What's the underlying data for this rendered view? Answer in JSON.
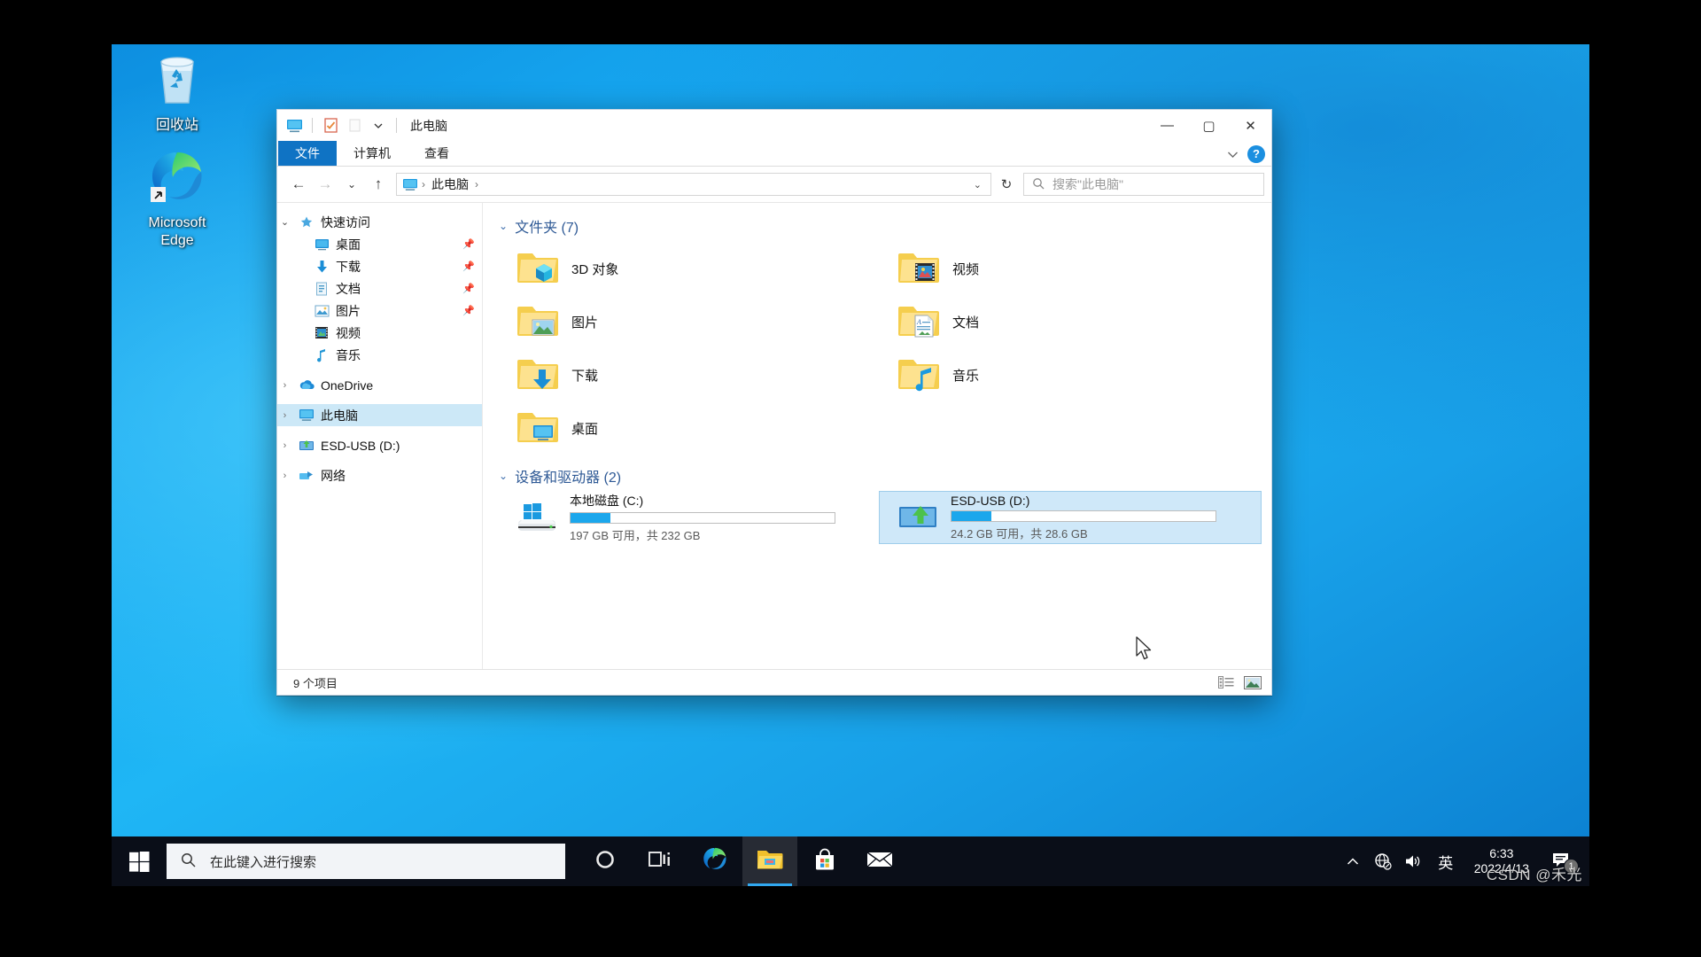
{
  "desktop": {
    "icons": [
      {
        "label": "回收站",
        "icon": "recycle-bin-icon"
      },
      {
        "label": "Microsoft\nEdge",
        "label_line1": "Microsoft",
        "label_line2": "Edge",
        "icon": "microsoft-edge-icon"
      }
    ]
  },
  "window": {
    "title": "此电脑",
    "quick_access": [
      {
        "name": "this-pc-icon"
      },
      {
        "name": "properties-icon"
      },
      {
        "name": "new-folder-icon"
      },
      {
        "name": "customize-dropdown-icon"
      }
    ],
    "controls": {
      "minimize": "—",
      "maximize": "▢",
      "close": "✕"
    },
    "ribbon_tabs": [
      {
        "label": "文件",
        "active": true
      },
      {
        "label": "计算机",
        "active": false
      },
      {
        "label": "查看",
        "active": false
      }
    ],
    "ribbon_right": {
      "collapse": "chevron-down-icon",
      "help": "?"
    },
    "address": {
      "back": "←",
      "forward": "→",
      "recent": "⌄",
      "up": "↑",
      "crumb_icon": "this-pc-icon",
      "crumbs": [
        "此电脑"
      ],
      "crumb_sep": "›",
      "dropdown": "⌄",
      "refresh": "↻"
    },
    "search": {
      "placeholder": "搜索\"此电脑\"",
      "icon": "search-icon"
    },
    "navpane": [
      {
        "label": "快速访问",
        "icon": "star-pin-icon",
        "chevron": "expanded",
        "indent": 0,
        "pinned": false,
        "selected": false
      },
      {
        "label": "桌面",
        "icon": "desktop-icon",
        "chevron": "none",
        "indent": 1,
        "pinned": true,
        "selected": false
      },
      {
        "label": "下载",
        "icon": "downloads-icon",
        "chevron": "none",
        "indent": 1,
        "pinned": true,
        "selected": false
      },
      {
        "label": "文档",
        "icon": "documents-icon",
        "chevron": "none",
        "indent": 1,
        "pinned": true,
        "selected": false
      },
      {
        "label": "图片",
        "icon": "pictures-icon",
        "chevron": "none",
        "indent": 1,
        "pinned": true,
        "selected": false
      },
      {
        "label": "视频",
        "icon": "videos-icon",
        "chevron": "none",
        "indent": 1,
        "pinned": false,
        "selected": false
      },
      {
        "label": "音乐",
        "icon": "music-icon",
        "chevron": "none",
        "indent": 1,
        "pinned": false,
        "selected": false
      },
      {
        "label": "OneDrive",
        "icon": "onedrive-icon",
        "chevron": "collapsed",
        "indent": 0,
        "pinned": false,
        "selected": false
      },
      {
        "label": "此电脑",
        "icon": "this-pc-icon",
        "chevron": "collapsed",
        "indent": 0,
        "pinned": false,
        "selected": true
      },
      {
        "label": "ESD-USB (D:)",
        "icon": "usb-drive-icon",
        "chevron": "collapsed",
        "indent": 0,
        "pinned": false,
        "selected": false
      },
      {
        "label": "网络",
        "icon": "network-icon",
        "chevron": "collapsed",
        "indent": 0,
        "pinned": false,
        "selected": false
      }
    ],
    "groups": {
      "folders": {
        "header": "文件夹 (7)",
        "items": [
          {
            "name": "3D 对象",
            "icon": "folder-3d-objects-icon"
          },
          {
            "name": "视频",
            "icon": "folder-videos-icon"
          },
          {
            "name": "图片",
            "icon": "folder-pictures-icon"
          },
          {
            "name": "文档",
            "icon": "folder-documents-icon"
          },
          {
            "name": "下载",
            "icon": "folder-downloads-icon"
          },
          {
            "name": "音乐",
            "icon": "folder-music-icon"
          },
          {
            "name": "桌面",
            "icon": "folder-desktop-icon"
          }
        ]
      },
      "drives": {
        "header": "设备和驱动器 (2)",
        "items": [
          {
            "name": "本地磁盘 (C:)",
            "icon": "local-disk-icon",
            "free_text": "197 GB 可用，共 232 GB",
            "used_percent": 15,
            "selected": false
          },
          {
            "name": "ESD-USB (D:)",
            "icon": "usb-drive-icon",
            "free_text": "24.2 GB 可用，共 28.6 GB",
            "used_percent": 15,
            "selected": true
          }
        ]
      }
    },
    "status": {
      "item_count": "9 个项目",
      "view_details": "details-view-icon",
      "view_large_icons": "large-icons-view-icon"
    }
  },
  "taskbar": {
    "start": "windows-start-icon",
    "search": {
      "placeholder": "在此键入进行搜索",
      "icon": "search-icon"
    },
    "apps": [
      {
        "name": "cortana-icon",
        "active": false
      },
      {
        "name": "task-view-icon",
        "active": false
      },
      {
        "name": "microsoft-edge-icon",
        "active": false
      },
      {
        "name": "file-explorer-icon",
        "active": true
      },
      {
        "name": "microsoft-store-icon",
        "active": false
      },
      {
        "name": "mail-icon",
        "active": false
      }
    ],
    "tray": {
      "overflow": "chevron-up-icon",
      "network": "network-disconnected-icon",
      "volume": "volume-icon",
      "ime": "英",
      "time": "6:33",
      "date": "2022/4/13",
      "action_center": "action-center-icon",
      "notification_count": "1"
    }
  },
  "watermark": "CSDN @禾光",
  "colors": {
    "accent": "#0f73c4",
    "selection": "#cce8f7",
    "drive_bar": "#1ca7ec",
    "group_header": "#2f5a96",
    "taskbar": "#0a0e18",
    "desktop": "#16a6ef"
  }
}
